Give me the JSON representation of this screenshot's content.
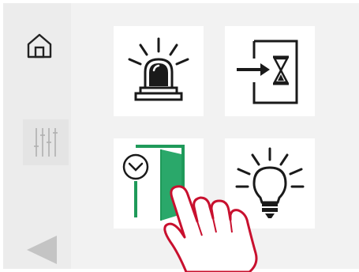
{
  "colors": {
    "background": "#efefef",
    "tile": "#ffffff",
    "icon": "#1a1a1a",
    "door_accent": "#1f9a5a",
    "hand_outline": "#c8102e",
    "sidebar_icon": "#b0b0b0"
  },
  "sidebar": {
    "items": [
      {
        "name": "home",
        "icon": "house-icon"
      },
      {
        "name": "settings",
        "icon": "sliders-icon"
      },
      {
        "name": "back",
        "icon": "triangle-left-icon"
      }
    ]
  },
  "tiles": [
    {
      "name": "alarm",
      "icon": "siren-icon"
    },
    {
      "name": "delay",
      "icon": "entry-delay-icon"
    },
    {
      "name": "door-timer",
      "icon": "door-clock-icon"
    },
    {
      "name": "light",
      "icon": "light-bulb-icon"
    }
  ],
  "overlay": {
    "icon": "pointing-hand-icon"
  }
}
